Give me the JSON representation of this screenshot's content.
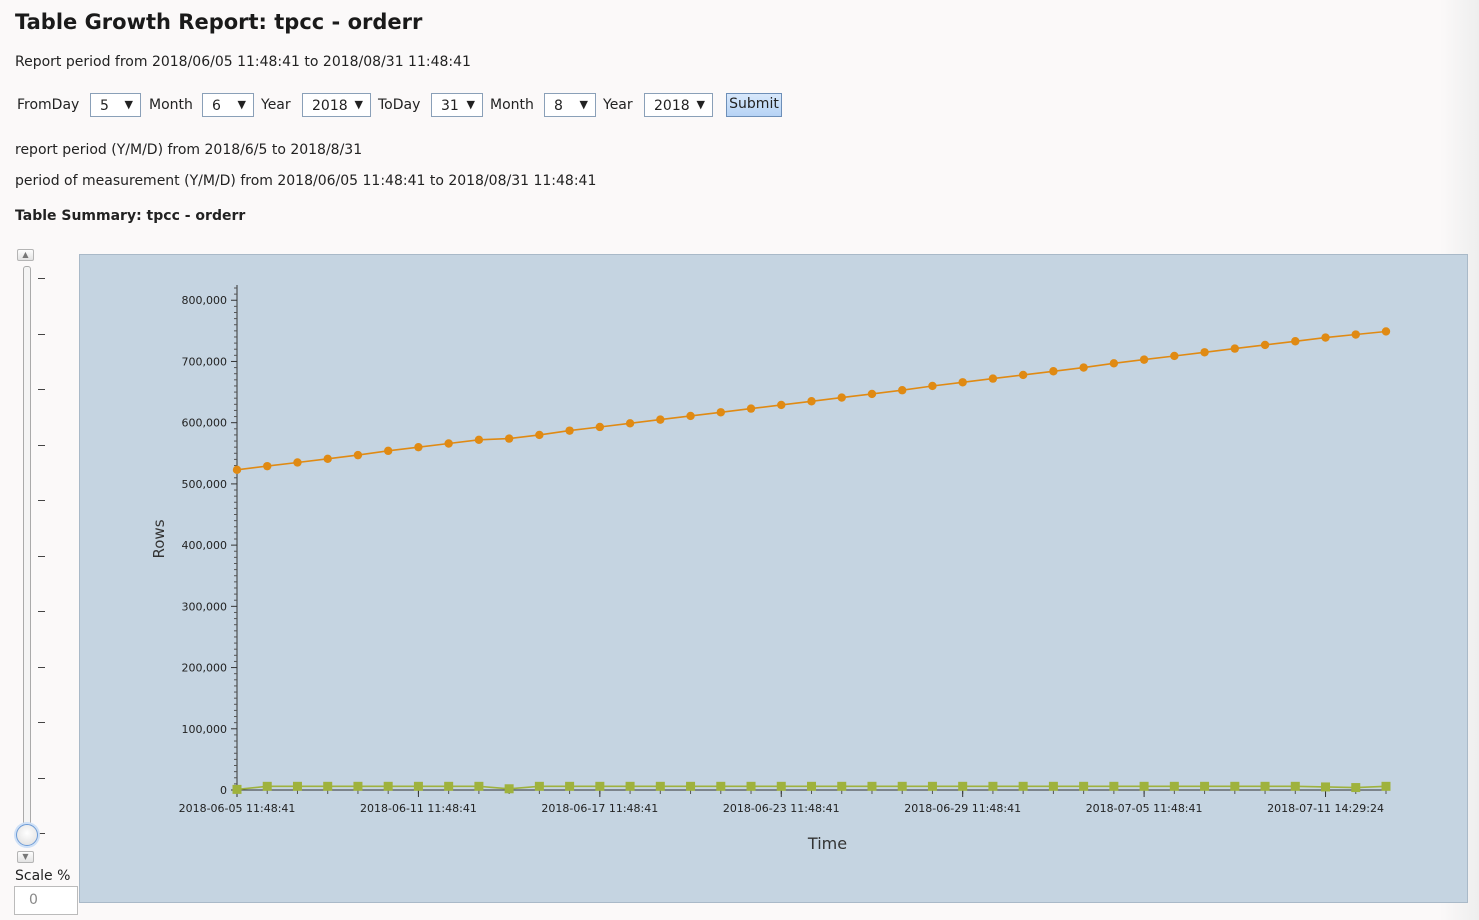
{
  "header": {
    "title": "Table Growth Report: tpcc - orderr",
    "report_period": "Report period from 2018/06/05 11:48:41 to 2018/08/31 11:48:41"
  },
  "form": {
    "from_day_label": "FromDay",
    "from_day": "5",
    "from_month_label": "Month",
    "from_month": "6",
    "from_year_label": "Year",
    "from_year": "2018",
    "to_day_label": "ToDay",
    "to_day": "31",
    "to_month_label": "Month",
    "to_month": "8",
    "to_year_label": "Year",
    "to_year": "2018",
    "submit_label": "Submit",
    "dropdown_arrow": "▼"
  },
  "info": {
    "report_period_ymd": "report period (Y/M/D) from 2018/6/5 to 2018/8/31",
    "measurement_period": "period of measurement (Y/M/D) from 2018/06/05 11:48:41 to 2018/08/31 11:48:41",
    "summary_title": "Table Summary: tpcc - orderr"
  },
  "scale": {
    "label": "Scale %",
    "value": "0",
    "up_icon": "triangle-up",
    "down_icon": "triangle-down"
  },
  "colors": {
    "plot_background": "#c5d4e1",
    "series_orange": "#e08a13",
    "series_green": "#9fb23d"
  },
  "chart_data": {
    "type": "line",
    "xlabel": "Time",
    "ylabel": "Rows",
    "ylim": [
      0,
      820000
    ],
    "y_ticks": [
      "0",
      "100,000",
      "200,000",
      "300,000",
      "400,000",
      "500,000",
      "600,000",
      "700,000",
      "800,000"
    ],
    "y_tick_values": [
      0,
      100000,
      200000,
      300000,
      400000,
      500000,
      600000,
      700000,
      800000
    ],
    "x_tick_labels": [
      {
        "index": 0,
        "label": "2018-06-05 11:48:41"
      },
      {
        "index": 6,
        "label": "2018-06-11 11:48:41"
      },
      {
        "index": 12,
        "label": "2018-06-17 11:48:41"
      },
      {
        "index": 18,
        "label": "2018-06-23 11:48:41"
      },
      {
        "index": 24,
        "label": "2018-06-29 11:48:41"
      },
      {
        "index": 30,
        "label": "2018-07-05 11:48:41"
      },
      {
        "index": 36,
        "label": "2018-07-11 14:29:24"
      }
    ],
    "grid": false,
    "legend": "none",
    "series": [
      {
        "marker": "circle",
        "color": "#e08a13",
        "values": [
          523000,
          529000,
          535000,
          541000,
          547000,
          554000,
          560000,
          566000,
          572000,
          574000,
          580000,
          587000,
          593000,
          599000,
          605000,
          611000,
          617000,
          623000,
          629000,
          635000,
          641000,
          647000,
          653000,
          660000,
          666000,
          672000,
          678000,
          684000,
          690000,
          697000,
          703000,
          709000,
          715000,
          721000,
          727000,
          733000,
          739000,
          744000,
          749000
        ]
      },
      {
        "marker": "square",
        "color": "#9fb23d",
        "values": [
          1000,
          6000,
          6000,
          6000,
          6000,
          6000,
          6000,
          6000,
          6000,
          2000,
          6000,
          6000,
          6000,
          6000,
          6000,
          6000,
          6000,
          6000,
          6000,
          6000,
          6000,
          6000,
          6000,
          6000,
          6000,
          6000,
          6000,
          6000,
          6000,
          6000,
          6000,
          6000,
          6000,
          6000,
          6000,
          6000,
          5000,
          4000,
          6000
        ]
      }
    ]
  }
}
